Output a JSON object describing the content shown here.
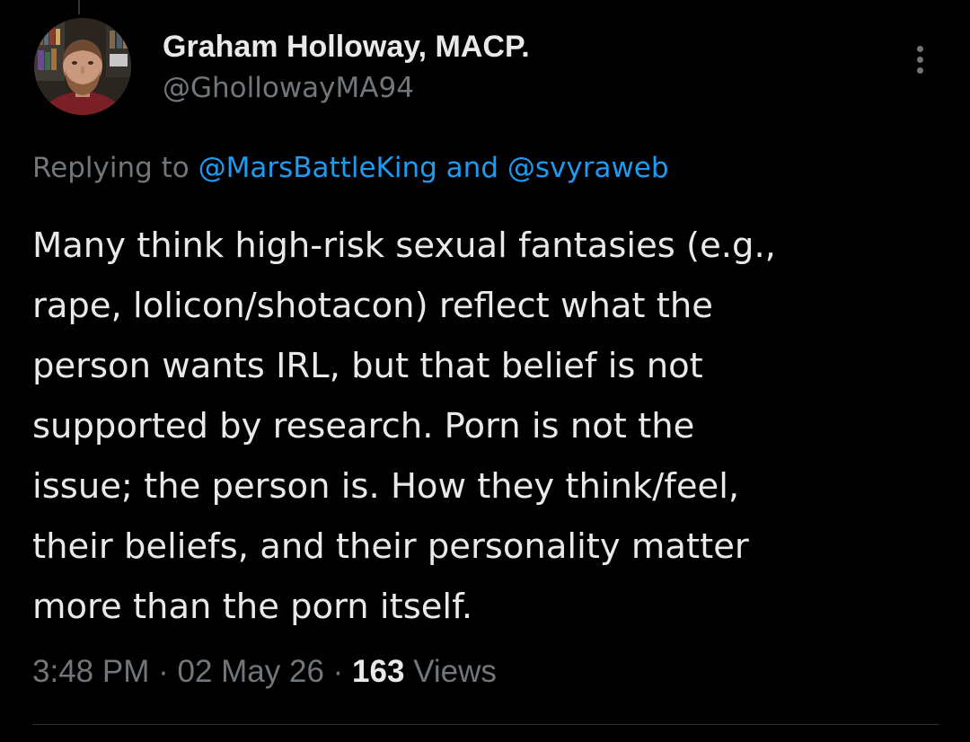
{
  "tweet": {
    "author": {
      "display_name": "Graham Holloway, MACP.",
      "handle": "@GhollowayMA94",
      "avatar_icon": "profile-photo"
    },
    "more_icon": "more-options-icon",
    "replying_to": {
      "prefix": "Replying to",
      "mention_1": "@MarsBattleKing",
      "conjunction": "and",
      "mention_2": "@svyraweb"
    },
    "text_lines": [
      "Many think high-risk sexual fantasies (e.g.,",
      "rape, lolicon/shotacon) reflect what the",
      "person wants IRL, but that belief is not",
      "supported by research. Porn is not the",
      "issue; the person is. How they think/feel,",
      "their beliefs, and their personality matter",
      "more than the porn itself."
    ],
    "meta": {
      "time": "3:48 PM",
      "separator": "·",
      "date": "02 May 26",
      "views_count": "163",
      "views_label": "Views"
    }
  },
  "colors": {
    "background": "#000000",
    "primary_text": "#e7e9ea",
    "secondary_text": "#71767b",
    "link": "#1d9bf0",
    "divider": "#2f3336"
  }
}
